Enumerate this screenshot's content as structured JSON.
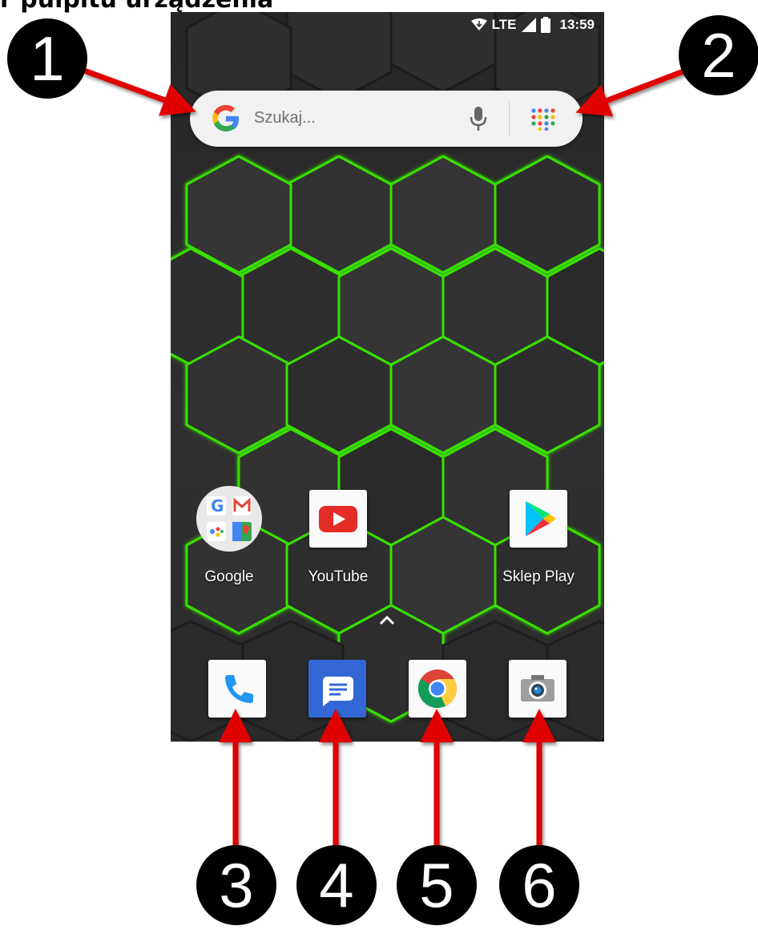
{
  "heading": "r pulpitu urządzenia",
  "statusbar": {
    "network": "LTE",
    "time": "13:59"
  },
  "search": {
    "placeholder": "Szukaj..."
  },
  "apps": [
    {
      "label": "Google"
    },
    {
      "label": "YouTube"
    },
    {
      "label": "Sklep Play"
    }
  ],
  "dock": [
    "phone-icon",
    "messages-icon",
    "chrome-icon",
    "camera-icon"
  ],
  "callouts": [
    "1",
    "2",
    "3",
    "4",
    "5",
    "6"
  ],
  "colors": {
    "arrow": "#e00000",
    "hex_glow": "#39e000",
    "youtube": "#e52d27",
    "messages": "#3367d6",
    "phone": "#2196f3"
  }
}
